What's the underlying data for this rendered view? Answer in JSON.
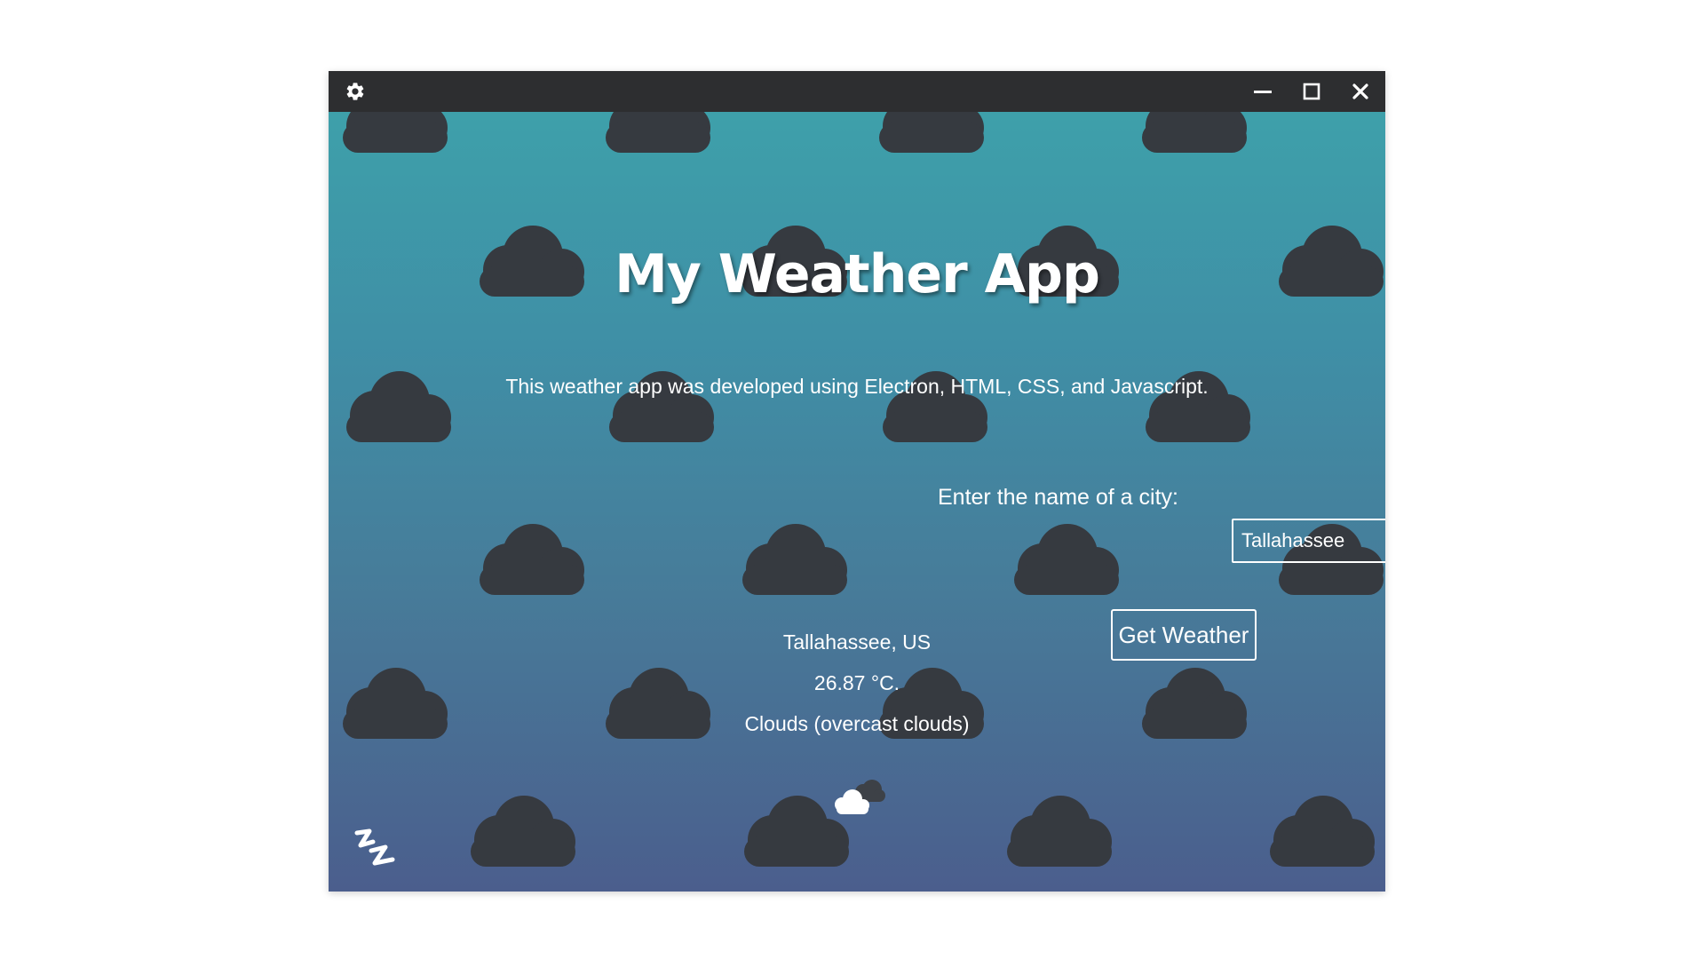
{
  "titlebar": {
    "settings_icon": "gear-icon",
    "minimize_icon": "minimize-icon",
    "maximize_icon": "maximize-icon",
    "close_icon": "close-icon",
    "background": "#2d2e30"
  },
  "app": {
    "title": "My Weather App",
    "description": "This weather app was developed using Electron, HTML, CSS, and Javascript.",
    "city_label": "Enter the name of a city:",
    "city_input_value": "Tallahassee",
    "button_label": "Get Weather"
  },
  "result": {
    "location": "Tallahassee, US",
    "temperature": "26.87 °C.",
    "condition": "Clouds (overcast clouds)",
    "icon": "overcast-clouds-icon"
  },
  "footer": {
    "logo_icon": "zz-logo-icon"
  },
  "colors": {
    "gradient_top": "#3ea0aa",
    "gradient_bottom": "#4b5e8d",
    "cloud_pattern": "#363a40",
    "text": "#ffffff"
  }
}
